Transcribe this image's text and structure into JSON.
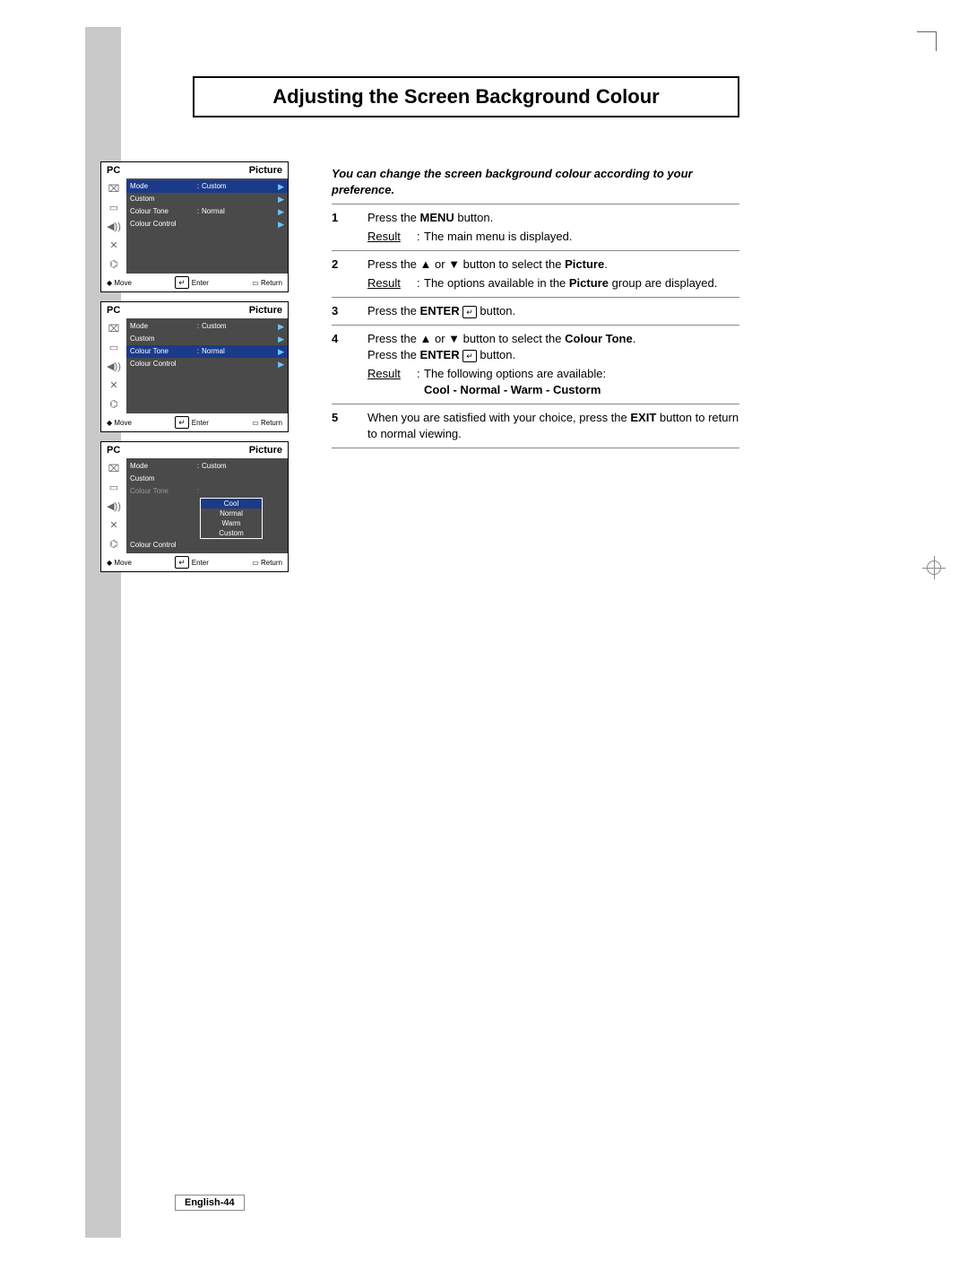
{
  "title": "Adjusting the Screen Background Colour",
  "intro": "You can change the screen background colour according to your preference.",
  "page_label": "English-44",
  "screens": [
    {
      "header_left": "PC",
      "header_right": "Picture",
      "rows": [
        {
          "label": "Mode",
          "sep": ":",
          "val": "Custom",
          "arrow": true,
          "hl": true
        },
        {
          "label": "Custom",
          "sep": "",
          "val": "",
          "arrow": true
        },
        {
          "label": "Colour Tone",
          "sep": ":",
          "val": "Normal",
          "arrow": true
        },
        {
          "label": "Colour Control",
          "sep": "",
          "val": "",
          "arrow": true
        }
      ],
      "dropdown": null,
      "footer": {
        "move": "Move",
        "enter": "Enter",
        "ret": "Return"
      }
    },
    {
      "header_left": "PC",
      "header_right": "Picture",
      "rows": [
        {
          "label": "Mode",
          "sep": ":",
          "val": "Custom",
          "arrow": true
        },
        {
          "label": "Custom",
          "sep": "",
          "val": "",
          "arrow": true
        },
        {
          "label": "Colour Tone",
          "sep": ":",
          "val": "Normal",
          "arrow": true,
          "hl": true
        },
        {
          "label": "Colour Control",
          "sep": "",
          "val": "",
          "arrow": true
        }
      ],
      "dropdown": null,
      "footer": {
        "move": "Move",
        "enter": "Enter",
        "ret": "Return"
      }
    },
    {
      "header_left": "PC",
      "header_right": "Picture",
      "rows": [
        {
          "label": "Mode",
          "sep": ":",
          "val": "Custom",
          "arrow": false
        },
        {
          "label": "Custom",
          "sep": "",
          "val": "",
          "arrow": false
        },
        {
          "label": "Colour Tone",
          "sep": ":",
          "val": "",
          "arrow": false,
          "dim": true
        },
        {
          "label": "Colour Control",
          "sep": "",
          "val": "",
          "arrow": false
        }
      ],
      "dropdown": {
        "options": [
          "Cool",
          "Normal",
          "Warm",
          "Custom"
        ],
        "selected": 0
      },
      "footer": {
        "move": "Move",
        "enter": "Enter",
        "ret": "Return"
      }
    }
  ],
  "steps": [
    {
      "num": "1",
      "lines": [
        {
          "html": "Press the <b>MENU</b> button."
        }
      ],
      "result": "The main menu is displayed."
    },
    {
      "num": "2",
      "lines": [
        {
          "html": "Press the ▲ or ▼ button to select the <b>Picture</b>."
        }
      ],
      "result_html": "The options available in the <b>Picture</b> group are displayed."
    },
    {
      "num": "3",
      "lines": [
        {
          "html": "Press the <b>ENTER</b> <span class='enter-icon'>↵</span> button."
        }
      ]
    },
    {
      "num": "4",
      "lines": [
        {
          "html": "Press the ▲ or ▼ button to select the <b>Colour Tone</b>."
        },
        {
          "html": "Press the <b>ENTER</b> <span class='enter-icon'>↵</span> button."
        }
      ],
      "result_lines": [
        "The following options are available:",
        "<b>Cool - Normal - Warm - Custorm</b>"
      ]
    },
    {
      "num": "5",
      "lines": [
        {
          "html": "When you are satisfied with your choice, press the <b>EXIT</b> button to return to normal viewing."
        }
      ]
    }
  ],
  "icons": [
    "⌧",
    "▭",
    "◀))",
    "✕",
    "⌬"
  ],
  "foot_icons": {
    "move": "◆",
    "enter": "↵",
    "ret": "▭"
  },
  "labels": {
    "result": "Result"
  }
}
